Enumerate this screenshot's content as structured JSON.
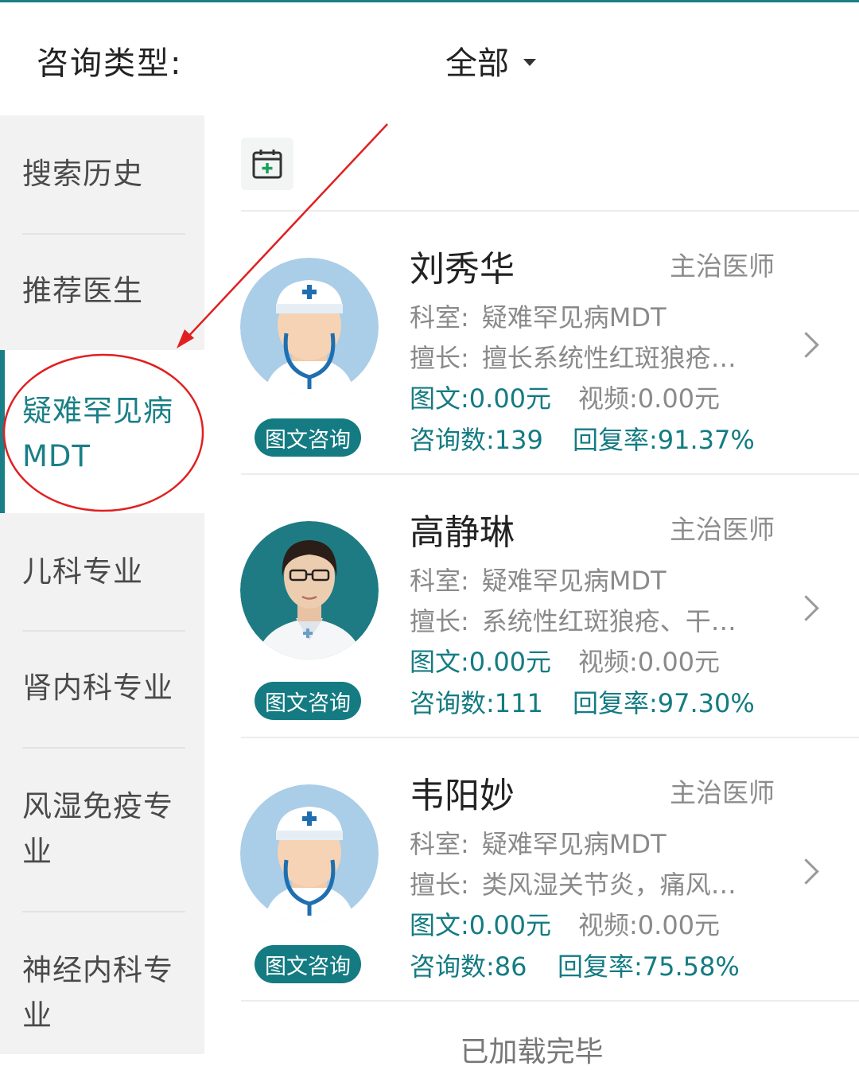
{
  "header": {
    "label": "咨询类型:",
    "filter_value": "全部"
  },
  "sidebar": {
    "items": [
      {
        "label": "搜索历史"
      },
      {
        "label": "推荐医生"
      },
      {
        "label": "疑难罕见病MDT",
        "active": true
      },
      {
        "label": "儿科专业"
      },
      {
        "label": "肾内科专业"
      },
      {
        "label": "风湿免疫专业"
      },
      {
        "label": "神经内科专业"
      }
    ]
  },
  "labels": {
    "dept_key": "科室:",
    "skill_key": "擅长:",
    "consult_button": "图文咨询"
  },
  "doctors": [
    {
      "name": "刘秀华",
      "title": "主治医师",
      "department": "疑难罕见病MDT",
      "specialty": "擅长系统性红斑狼疮…",
      "text_price": "图文:0.00元",
      "video_price": "视频:0.00元",
      "consult_count": "咨询数:139",
      "reply_rate": "回复率:91.37%",
      "avatar": "default-doctor-avatar"
    },
    {
      "name": "高静琳",
      "title": "主治医师",
      "department": "疑难罕见病MDT",
      "specialty": "系统性红斑狼疮、干…",
      "text_price": "图文:0.00元",
      "video_price": "视频:0.00元",
      "consult_count": "咨询数:111",
      "reply_rate": "回复率:97.30%",
      "avatar": "doctor-photo"
    },
    {
      "name": "韦阳妙",
      "title": "主治医师",
      "department": "疑难罕见病MDT",
      "specialty": "类风湿关节炎，痛风…",
      "text_price": "图文:0.00元",
      "video_price": "视频:0.00元",
      "consult_count": "咨询数:86",
      "reply_rate": "回复率:75.58%",
      "avatar": "default-doctor-avatar"
    }
  ],
  "footer": {
    "loaded_text": "已加载完毕"
  },
  "colors": {
    "accent": "#147b82",
    "annotation": "#e02020"
  }
}
